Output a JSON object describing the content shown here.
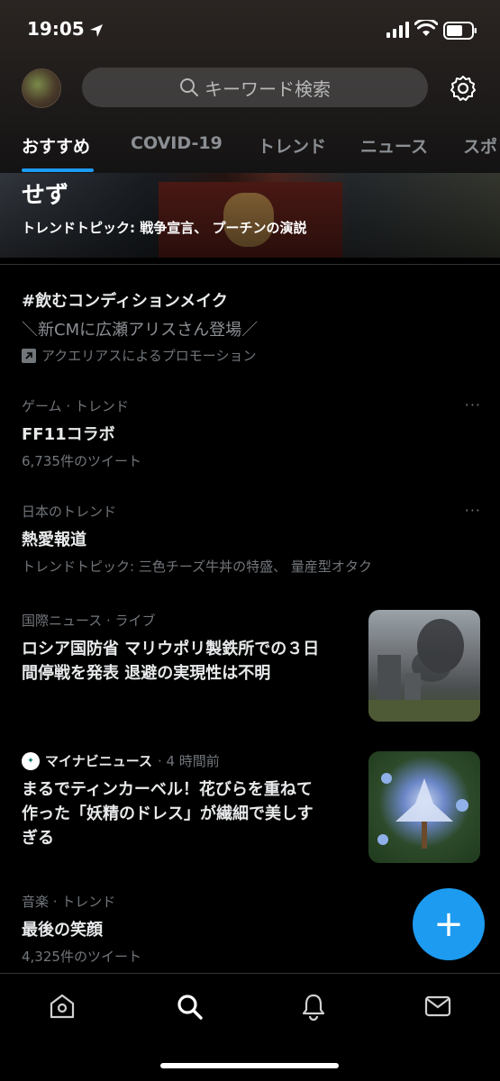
{
  "status": {
    "time": "19:05"
  },
  "search": {
    "placeholder": "キーワード検索"
  },
  "tabs": [
    {
      "label": "おすすめ"
    },
    {
      "label": "COVID-19"
    },
    {
      "label": "トレンド"
    },
    {
      "label": "ニュース"
    },
    {
      "label": "スポ"
    }
  ],
  "hero": {
    "title": "せず",
    "subtitle": "トレンドトピック: 戦争宣言、 プーチンの演説"
  },
  "promo": {
    "title": "#飲むコンディションメイク",
    "subtitle": "＼新CMに広瀬アリスさん登場／",
    "promoted_by": "アクエリアスによるプロモーション"
  },
  "trends": [
    {
      "meta": "ゲーム · トレンド",
      "title": "FF11コラボ",
      "sub": "6,735件のツイート",
      "more": "···"
    },
    {
      "meta": "日本のトレンド",
      "title": "熱愛報道",
      "sub": "トレンドトピック: 三色チーズ牛丼の特盛、 量産型オタク",
      "more": "···"
    }
  ],
  "news": [
    {
      "meta": "国際ニュース · ライブ",
      "title_lines": [
        "ロシア国防省 マリウポリ製鉄所での３日",
        "間停戦を発表 退避の実現性は不明"
      ]
    },
    {
      "source": "マイナビニュース",
      "time": "· 4 時間前",
      "title_lines": [
        "まるでティンカーベル！花びらを重ねて",
        "作った「妖精のドレス」が繊細で美しす",
        "ぎる"
      ]
    }
  ],
  "trend_bottom": {
    "meta": "音楽 · トレンド",
    "title": "最後の笑顔",
    "sub": "4,325件のツイート"
  },
  "fab": {
    "label": "+"
  },
  "colors": {
    "accent": "#1d9bf0",
    "background": "#000000",
    "secondary_text": "#71767b"
  },
  "icons": [
    "location-arrow-icon",
    "signal-icon",
    "wifi-icon",
    "battery-icon",
    "search-icon",
    "gear-icon",
    "promoted-icon",
    "home-icon",
    "explore-icon",
    "bell-icon",
    "mail-icon"
  ]
}
